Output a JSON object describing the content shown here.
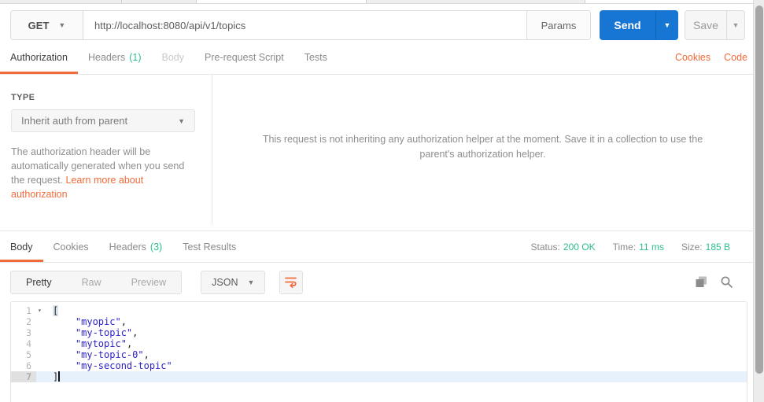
{
  "request": {
    "method": "GET",
    "url": "http://localhost:8080/api/v1/topics",
    "params_label": "Params",
    "send_label": "Send",
    "save_label": "Save",
    "tabs": [
      {
        "label": "Authorization"
      },
      {
        "label": "Headers",
        "count": "(1)"
      },
      {
        "label": "Body"
      },
      {
        "label": "Pre-request Script"
      },
      {
        "label": "Tests"
      }
    ],
    "cookies_link": "Cookies",
    "code_link": "Code"
  },
  "auth": {
    "type_label": "TYPE",
    "type_value": "Inherit auth from parent",
    "help_text": "The authorization header will be automatically generated when you send the request. ",
    "help_link": "Learn more about authorization",
    "helper_message": "This request is not inheriting any authorization helper at the moment. Save it in a collection to use the parent's authorization helper."
  },
  "response": {
    "tabs": [
      {
        "label": "Body"
      },
      {
        "label": "Cookies"
      },
      {
        "label": "Headers",
        "count": "(3)"
      },
      {
        "label": "Test Results"
      }
    ],
    "meta": {
      "status_label": "Status:",
      "status_value": "200 OK",
      "time_label": "Time:",
      "time_value": "11 ms",
      "size_label": "Size:",
      "size_value": "185 B"
    },
    "toolbar": {
      "pretty": "Pretty",
      "raw": "Raw",
      "preview": "Preview",
      "format": "JSON"
    },
    "editor": {
      "lines": [
        {
          "num": "1",
          "fold": true,
          "tokens": [
            [
              "pm",
              "["
            ]
          ]
        },
        {
          "num": "2",
          "tokens": [
            [
              "w",
              "    "
            ],
            [
              "s",
              "\"myopic\""
            ],
            [
              "p",
              ","
            ]
          ]
        },
        {
          "num": "3",
          "tokens": [
            [
              "w",
              "    "
            ],
            [
              "s",
              "\"my-topic\""
            ],
            [
              "p",
              ","
            ]
          ]
        },
        {
          "num": "4",
          "tokens": [
            [
              "w",
              "    "
            ],
            [
              "s",
              "\"mytopic\""
            ],
            [
              "p",
              ","
            ]
          ]
        },
        {
          "num": "5",
          "tokens": [
            [
              "w",
              "    "
            ],
            [
              "s",
              "\"my-topic-0\""
            ],
            [
              "p",
              ","
            ]
          ]
        },
        {
          "num": "6",
          "tokens": [
            [
              "w",
              "    "
            ],
            [
              "s",
              "\"my-second-topic\""
            ]
          ]
        },
        {
          "num": "7",
          "active": true,
          "cursor": true,
          "tokens": [
            [
              "p",
              "]"
            ]
          ]
        }
      ]
    }
  },
  "colors": {
    "accent_orange": "#f26b3a",
    "send_blue": "#1776d3",
    "success_green": "#2cbe8e",
    "string_blue": "#2d23c8"
  }
}
